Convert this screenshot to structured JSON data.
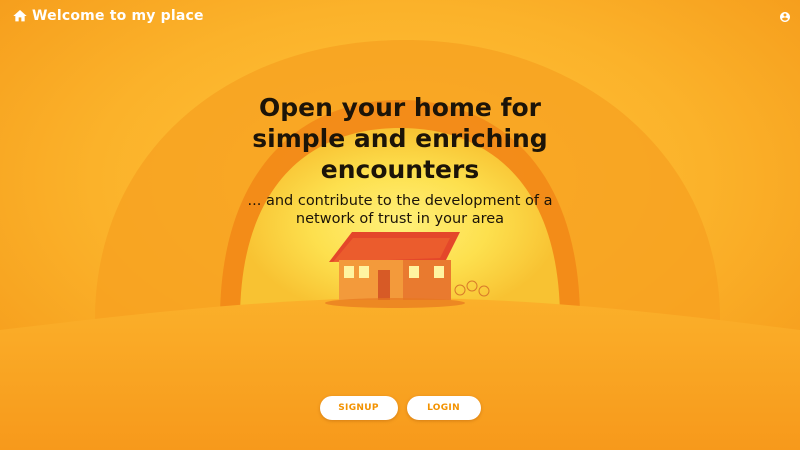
{
  "header": {
    "brand_title": "Welcome to my place",
    "brand_icon": "home-icon",
    "account_icon": "account-circle-icon"
  },
  "hero": {
    "headline_line1": "Open your home for",
    "headline_line2": "simple and enriching",
    "headline_line3": "encounters",
    "subline_line1": "... and contribute to the development of a",
    "subline_line2": "network of trust in your area"
  },
  "actions": {
    "signup_label": "SIGNUP",
    "login_label": "LOGIN"
  },
  "colors": {
    "background": "#f7a51c",
    "sun": "#f7d94a",
    "button_bg": "#ffffff",
    "button_text": "#f39200",
    "headline_text": "#1c1408"
  },
  "illustration": "sunset-house-illustration"
}
